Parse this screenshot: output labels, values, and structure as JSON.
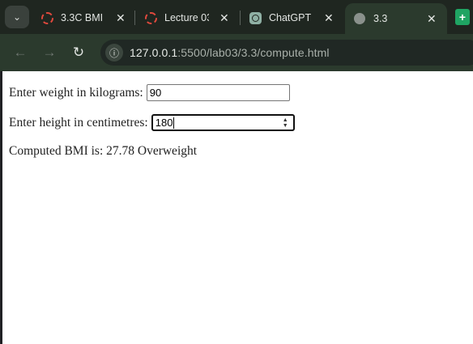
{
  "browser": {
    "tabs": [
      {
        "title": "3.3C BMI",
        "icon": "ring-icon"
      },
      {
        "title": "Lecture 03",
        "icon": "ring-icon"
      },
      {
        "title": "ChatGPT",
        "icon": "chatgpt-icon"
      },
      {
        "title": "3.3",
        "icon": "globe-icon",
        "active": true
      }
    ],
    "close_glyph": "✕",
    "url_host": "127.0.0.1",
    "url_path": ":5500/lab03/3.3/compute.html",
    "site_info_icon": "info-icon"
  },
  "form": {
    "weight_label": "Enter weight in kilograms:",
    "weight_value": "90",
    "height_label": "Enter height in centimetres:",
    "height_value": "180",
    "result_text": "Computed BMI is: 27.78 Overweight"
  },
  "colors": {
    "accent_new_tab": "#1fa463",
    "favicon_ring": "#e0493d"
  }
}
